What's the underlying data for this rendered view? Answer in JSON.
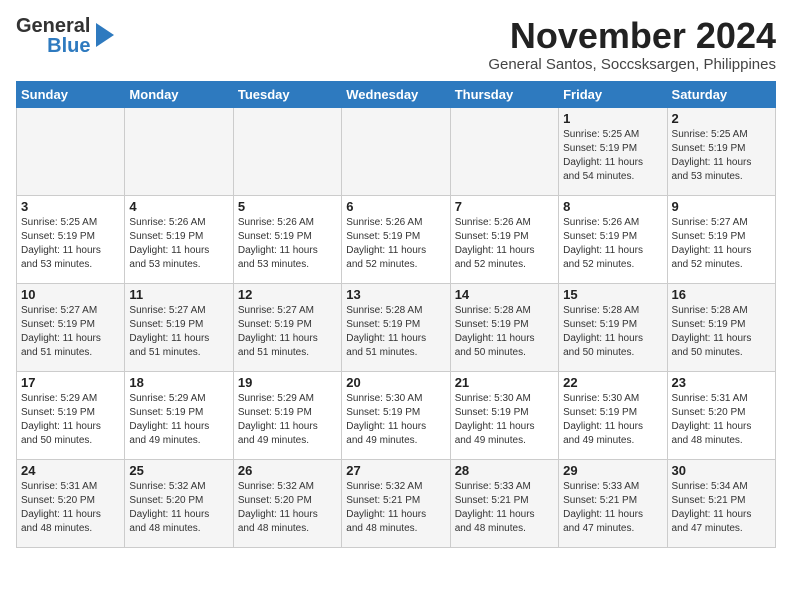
{
  "logo": {
    "general": "General",
    "blue": "Blue"
  },
  "header": {
    "month": "November 2024",
    "location": "General Santos, Soccsksargen, Philippines"
  },
  "weekdays": [
    "Sunday",
    "Monday",
    "Tuesday",
    "Wednesday",
    "Thursday",
    "Friday",
    "Saturday"
  ],
  "weeks": [
    [
      {
        "day": "",
        "info": ""
      },
      {
        "day": "",
        "info": ""
      },
      {
        "day": "",
        "info": ""
      },
      {
        "day": "",
        "info": ""
      },
      {
        "day": "",
        "info": ""
      },
      {
        "day": "1",
        "info": "Sunrise: 5:25 AM\nSunset: 5:19 PM\nDaylight: 11 hours\nand 54 minutes."
      },
      {
        "day": "2",
        "info": "Sunrise: 5:25 AM\nSunset: 5:19 PM\nDaylight: 11 hours\nand 53 minutes."
      }
    ],
    [
      {
        "day": "3",
        "info": "Sunrise: 5:25 AM\nSunset: 5:19 PM\nDaylight: 11 hours\nand 53 minutes."
      },
      {
        "day": "4",
        "info": "Sunrise: 5:26 AM\nSunset: 5:19 PM\nDaylight: 11 hours\nand 53 minutes."
      },
      {
        "day": "5",
        "info": "Sunrise: 5:26 AM\nSunset: 5:19 PM\nDaylight: 11 hours\nand 53 minutes."
      },
      {
        "day": "6",
        "info": "Sunrise: 5:26 AM\nSunset: 5:19 PM\nDaylight: 11 hours\nand 52 minutes."
      },
      {
        "day": "7",
        "info": "Sunrise: 5:26 AM\nSunset: 5:19 PM\nDaylight: 11 hours\nand 52 minutes."
      },
      {
        "day": "8",
        "info": "Sunrise: 5:26 AM\nSunset: 5:19 PM\nDaylight: 11 hours\nand 52 minutes."
      },
      {
        "day": "9",
        "info": "Sunrise: 5:27 AM\nSunset: 5:19 PM\nDaylight: 11 hours\nand 52 minutes."
      }
    ],
    [
      {
        "day": "10",
        "info": "Sunrise: 5:27 AM\nSunset: 5:19 PM\nDaylight: 11 hours\nand 51 minutes."
      },
      {
        "day": "11",
        "info": "Sunrise: 5:27 AM\nSunset: 5:19 PM\nDaylight: 11 hours\nand 51 minutes."
      },
      {
        "day": "12",
        "info": "Sunrise: 5:27 AM\nSunset: 5:19 PM\nDaylight: 11 hours\nand 51 minutes."
      },
      {
        "day": "13",
        "info": "Sunrise: 5:28 AM\nSunset: 5:19 PM\nDaylight: 11 hours\nand 51 minutes."
      },
      {
        "day": "14",
        "info": "Sunrise: 5:28 AM\nSunset: 5:19 PM\nDaylight: 11 hours\nand 50 minutes."
      },
      {
        "day": "15",
        "info": "Sunrise: 5:28 AM\nSunset: 5:19 PM\nDaylight: 11 hours\nand 50 minutes."
      },
      {
        "day": "16",
        "info": "Sunrise: 5:28 AM\nSunset: 5:19 PM\nDaylight: 11 hours\nand 50 minutes."
      }
    ],
    [
      {
        "day": "17",
        "info": "Sunrise: 5:29 AM\nSunset: 5:19 PM\nDaylight: 11 hours\nand 50 minutes."
      },
      {
        "day": "18",
        "info": "Sunrise: 5:29 AM\nSunset: 5:19 PM\nDaylight: 11 hours\nand 49 minutes."
      },
      {
        "day": "19",
        "info": "Sunrise: 5:29 AM\nSunset: 5:19 PM\nDaylight: 11 hours\nand 49 minutes."
      },
      {
        "day": "20",
        "info": "Sunrise: 5:30 AM\nSunset: 5:19 PM\nDaylight: 11 hours\nand 49 minutes."
      },
      {
        "day": "21",
        "info": "Sunrise: 5:30 AM\nSunset: 5:19 PM\nDaylight: 11 hours\nand 49 minutes."
      },
      {
        "day": "22",
        "info": "Sunrise: 5:30 AM\nSunset: 5:19 PM\nDaylight: 11 hours\nand 49 minutes."
      },
      {
        "day": "23",
        "info": "Sunrise: 5:31 AM\nSunset: 5:20 PM\nDaylight: 11 hours\nand 48 minutes."
      }
    ],
    [
      {
        "day": "24",
        "info": "Sunrise: 5:31 AM\nSunset: 5:20 PM\nDaylight: 11 hours\nand 48 minutes."
      },
      {
        "day": "25",
        "info": "Sunrise: 5:32 AM\nSunset: 5:20 PM\nDaylight: 11 hours\nand 48 minutes."
      },
      {
        "day": "26",
        "info": "Sunrise: 5:32 AM\nSunset: 5:20 PM\nDaylight: 11 hours\nand 48 minutes."
      },
      {
        "day": "27",
        "info": "Sunrise: 5:32 AM\nSunset: 5:21 PM\nDaylight: 11 hours\nand 48 minutes."
      },
      {
        "day": "28",
        "info": "Sunrise: 5:33 AM\nSunset: 5:21 PM\nDaylight: 11 hours\nand 48 minutes."
      },
      {
        "day": "29",
        "info": "Sunrise: 5:33 AM\nSunset: 5:21 PM\nDaylight: 11 hours\nand 47 minutes."
      },
      {
        "day": "30",
        "info": "Sunrise: 5:34 AM\nSunset: 5:21 PM\nDaylight: 11 hours\nand 47 minutes."
      }
    ]
  ]
}
